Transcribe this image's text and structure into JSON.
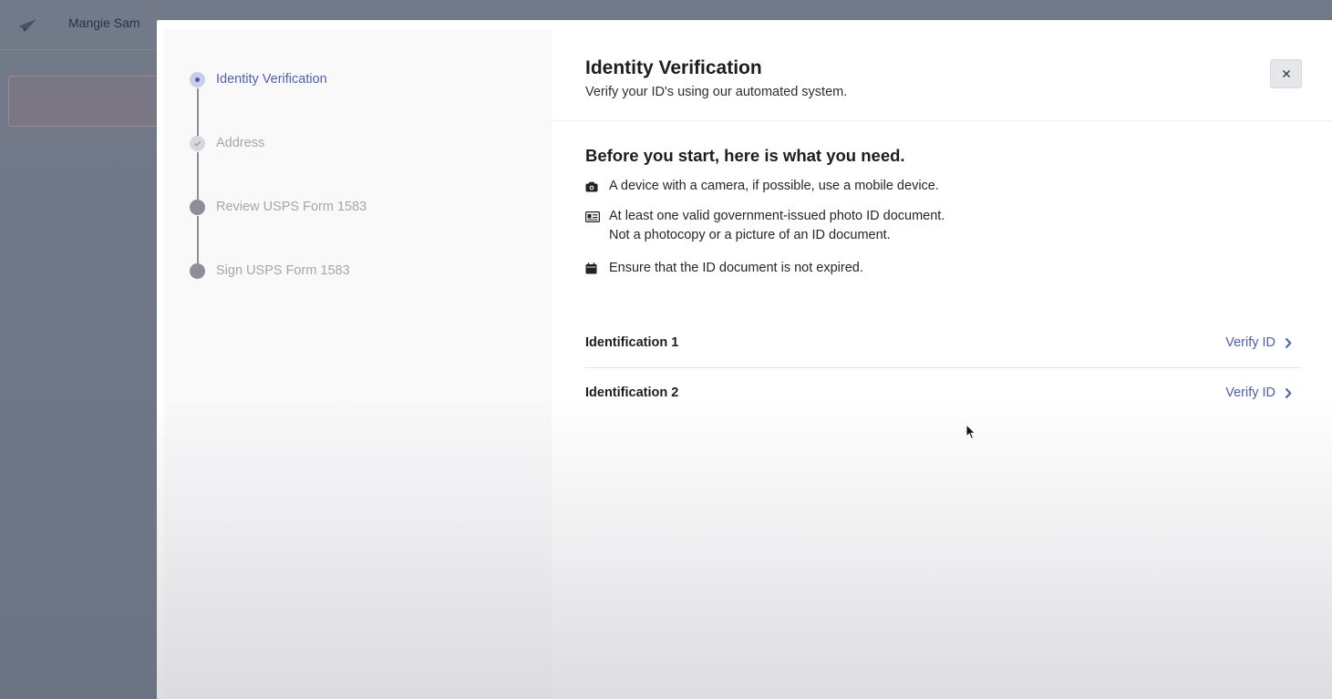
{
  "background": {
    "user_name": "Mangie Sam"
  },
  "stepper": {
    "steps": [
      {
        "label": "Identity Verification",
        "state": "active"
      },
      {
        "label": "Address",
        "state": "done"
      },
      {
        "label": "Review USPS Form 1583",
        "state": "pending"
      },
      {
        "label": "Sign USPS Form 1583",
        "state": "pending"
      }
    ]
  },
  "modal": {
    "title": "Identity Verification",
    "subtitle": "Verify your ID's using our automated system.",
    "close_icon": "close-icon",
    "requirements_heading": "Before you start, here is what you need.",
    "requirements": [
      {
        "icon": "camera-icon",
        "lines": [
          "A device with a camera, if possible, use a mobile device."
        ]
      },
      {
        "icon": "id-card-icon",
        "lines": [
          "At least one valid government-issued photo ID document.",
          "Not a photocopy or a picture of an ID document."
        ]
      },
      {
        "icon": "calendar-icon",
        "lines": [
          "Ensure that the ID document is not expired."
        ]
      }
    ],
    "identifications": [
      {
        "label": "Identification 1",
        "action": "Verify ID"
      },
      {
        "label": "Identification 2",
        "action": "Verify ID"
      }
    ]
  },
  "colors": {
    "accent": "#4d5cb5",
    "overlay": "#6f7787"
  }
}
